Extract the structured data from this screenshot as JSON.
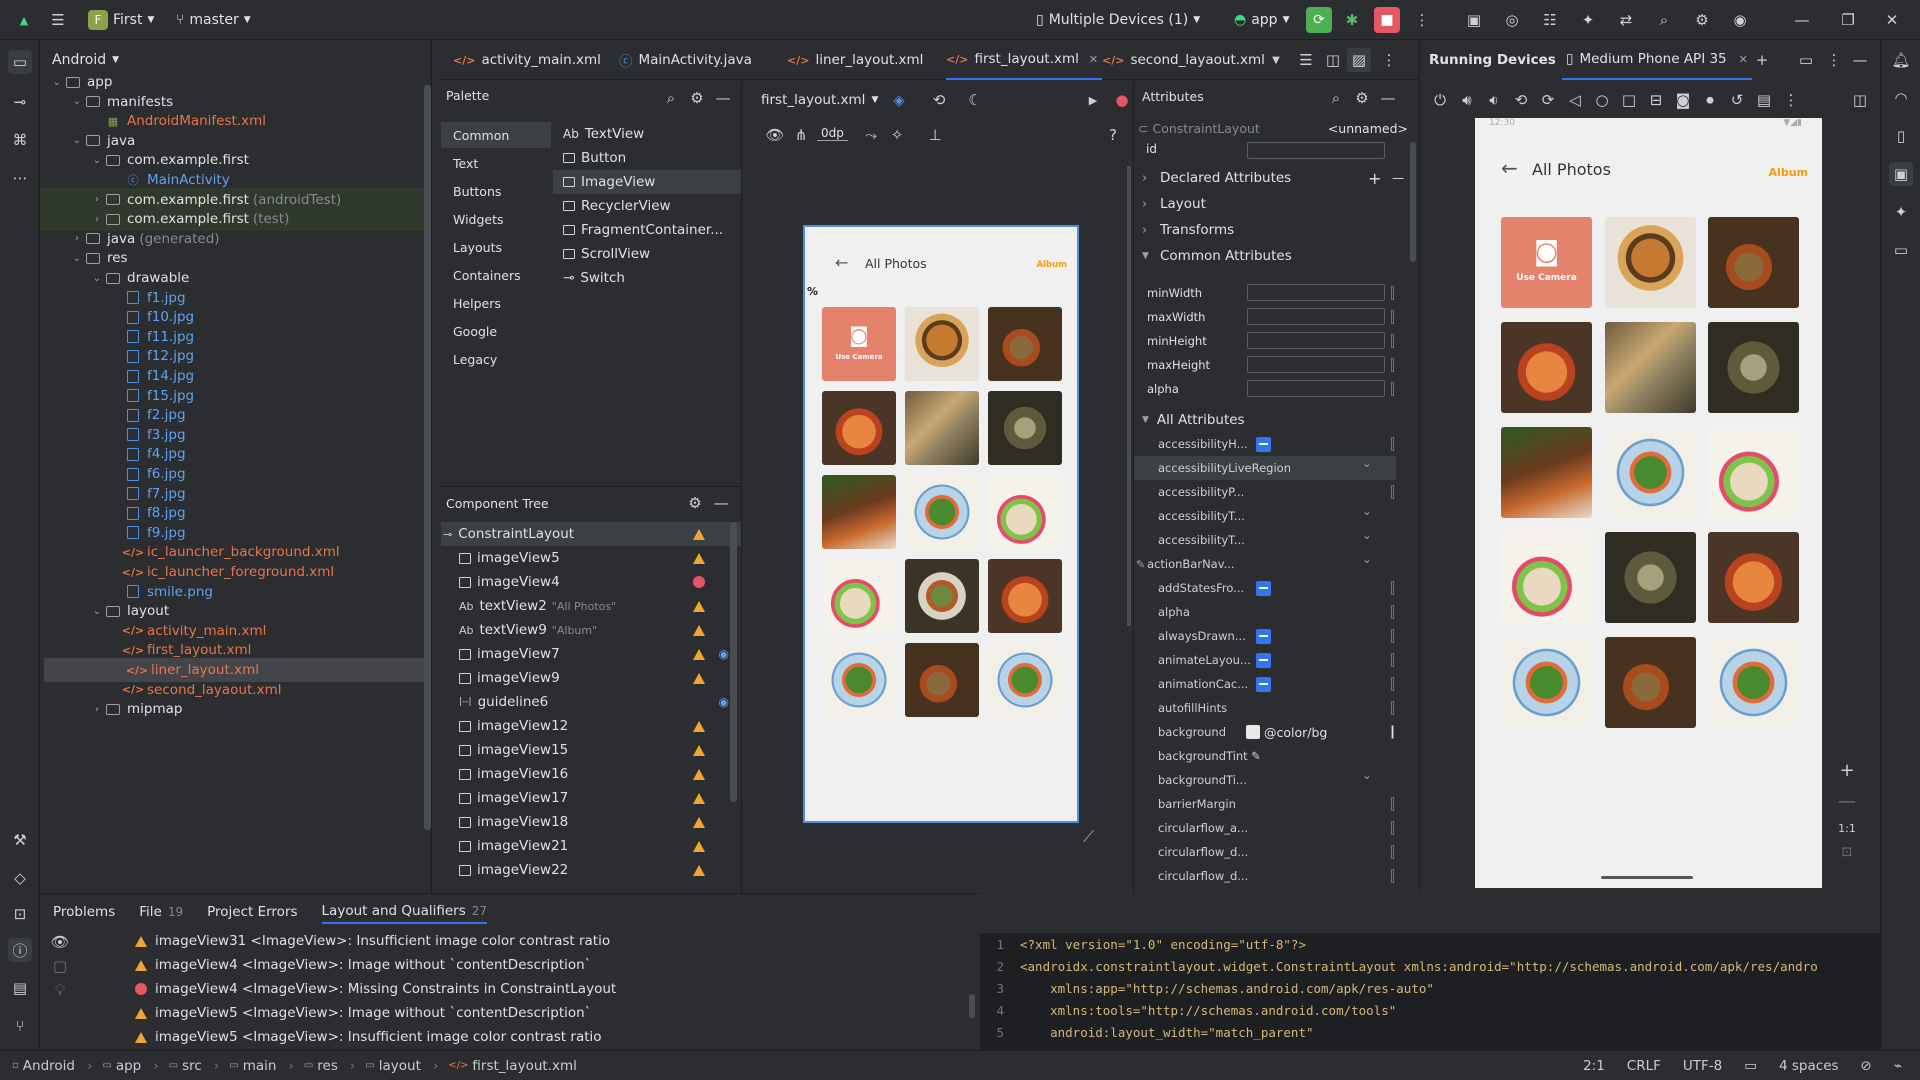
{
  "topbar": {
    "project_badge": "F",
    "project_name": "First",
    "branch": "master",
    "devices": "Multiple Devices (1)",
    "run_config": "app"
  },
  "project_panel": {
    "view_name": "Android",
    "tree": [
      {
        "label": "app",
        "depth": 0,
        "kind": "folder",
        "open": true
      },
      {
        "label": "manifests",
        "depth": 1,
        "kind": "folder",
        "open": true
      },
      {
        "label": "AndroidManifest.xml",
        "depth": 2,
        "kind": "manifest"
      },
      {
        "label": "java",
        "depth": 1,
        "kind": "folder",
        "open": true
      },
      {
        "label": "com.example.first",
        "depth": 2,
        "kind": "folder",
        "open": true
      },
      {
        "label": "MainActivity",
        "depth": 3,
        "kind": "class"
      },
      {
        "label": "com.example.first",
        "suffix": "(androidTest)",
        "depth": 2,
        "kind": "folder",
        "open": false,
        "hl": true
      },
      {
        "label": "com.example.first",
        "suffix": "(test)",
        "depth": 2,
        "kind": "folder",
        "open": false,
        "hl": true
      },
      {
        "label": "java",
        "suffix": "(generated)",
        "depth": 1,
        "kind": "folder"
      },
      {
        "label": "res",
        "depth": 1,
        "kind": "folder",
        "open": true
      },
      {
        "label": "drawable",
        "depth": 2,
        "kind": "folder",
        "open": true
      },
      {
        "label": "f1.jpg",
        "depth": 3,
        "kind": "image"
      },
      {
        "label": "f10.jpg",
        "depth": 3,
        "kind": "image"
      },
      {
        "label": "f11.jpg",
        "depth": 3,
        "kind": "image"
      },
      {
        "label": "f12.jpg",
        "depth": 3,
        "kind": "image"
      },
      {
        "label": "f14.jpg",
        "depth": 3,
        "kind": "image"
      },
      {
        "label": "f15.jpg",
        "depth": 3,
        "kind": "image"
      },
      {
        "label": "f2.jpg",
        "depth": 3,
        "kind": "image"
      },
      {
        "label": "f3.jpg",
        "depth": 3,
        "kind": "image"
      },
      {
        "label": "f4.jpg",
        "depth": 3,
        "kind": "image"
      },
      {
        "label": "f6.jpg",
        "depth": 3,
        "kind": "image"
      },
      {
        "label": "f7.jpg",
        "depth": 3,
        "kind": "image"
      },
      {
        "label": "f8.jpg",
        "depth": 3,
        "kind": "image"
      },
      {
        "label": "f9.jpg",
        "depth": 3,
        "kind": "image"
      },
      {
        "label": "ic_launcher_background.xml",
        "depth": 3,
        "kind": "xml"
      },
      {
        "label": "ic_launcher_foreground.xml",
        "depth": 3,
        "kind": "xml"
      },
      {
        "label": "smile.png",
        "depth": 3,
        "kind": "image"
      },
      {
        "label": "layout",
        "depth": 2,
        "kind": "folder",
        "open": true
      },
      {
        "label": "activity_main.xml",
        "depth": 3,
        "kind": "xml"
      },
      {
        "label": "first_layout.xml",
        "depth": 3,
        "kind": "xml"
      },
      {
        "label": "liner_layout.xml",
        "depth": 3,
        "kind": "xml",
        "selected": true
      },
      {
        "label": "second_layaout.xml",
        "depth": 3,
        "kind": "xml"
      },
      {
        "label": "mipmap",
        "depth": 2,
        "kind": "folder",
        "open": false
      }
    ]
  },
  "editor_tabs": [
    "activity_main.xml",
    "MainActivity.java",
    "liner_layout.xml",
    "first_layout.xml",
    "second_layaout.xml"
  ],
  "editor_active_tab": "first_layout.xml",
  "palette": {
    "title": "Palette",
    "categories": [
      "Common",
      "Text",
      "Buttons",
      "Widgets",
      "Layouts",
      "Containers",
      "Helpers",
      "Google",
      "Legacy"
    ],
    "items": [
      "TextView",
      "Button",
      "ImageView",
      "RecyclerView",
      "FragmentContainer...",
      "ScrollView",
      "Switch"
    ],
    "textview_prefix": "Ab"
  },
  "design_toolbar": {
    "file": "first_layout.xml",
    "margin": "0dp"
  },
  "component_tree": {
    "title": "Component Tree",
    "items": [
      {
        "label": "ConstraintLayout",
        "status": "warn",
        "root": true
      },
      {
        "label": "imageView5",
        "status": "warn"
      },
      {
        "label": "imageView4",
        "status": "error"
      },
      {
        "label": "textView2",
        "hint": "\"All Photos\"",
        "status": "warn",
        "text": true
      },
      {
        "label": "textView9",
        "hint": "\"Album\"",
        "status": "warn",
        "text": true
      },
      {
        "label": "imageView7",
        "status": "warn",
        "eye": true
      },
      {
        "label": "imageView9",
        "status": "warn"
      },
      {
        "label": "guideline6",
        "status": "eye",
        "guide": true
      },
      {
        "label": "imageView12",
        "status": "warn"
      },
      {
        "label": "imageView15",
        "status": "warn"
      },
      {
        "label": "imageView16",
        "status": "warn"
      },
      {
        "label": "imageView17",
        "status": "warn"
      },
      {
        "label": "imageView18",
        "status": "warn"
      },
      {
        "label": "imageView21",
        "status": "warn"
      },
      {
        "label": "imageView22",
        "status": "warn"
      }
    ]
  },
  "preview": {
    "title": "All Photos",
    "action": "Album",
    "camera_label": "Use Camera",
    "percent": "%",
    "grid": [
      [
        "camera",
        "burger",
        "salad"
      ],
      [
        "pasta",
        "spring",
        "dumpling"
      ],
      [
        "steak",
        "plate",
        "vegs"
      ],
      [
        "vegs",
        "bowl",
        "pasta"
      ],
      [
        "plate",
        "salad",
        "plate"
      ]
    ]
  },
  "attributes": {
    "title": "Attributes",
    "component": "ConstraintLayout",
    "unnamed": "<unnamed>",
    "id_label": "id",
    "sections": [
      "Declared Attributes",
      "Layout",
      "Transforms",
      "Common Attributes"
    ],
    "common": [
      "minWidth",
      "maxWidth",
      "minHeight",
      "maxHeight",
      "alpha"
    ],
    "all_title": "All Attributes",
    "all": [
      {
        "name": "accessibilityH...",
        "ctl": "check"
      },
      {
        "name": "accessibilityLiveRegion",
        "ctl": "dropdown",
        "hl": true
      },
      {
        "name": "accessibilityP...",
        "ctl": "sep"
      },
      {
        "name": "accessibilityT...",
        "ctl": "dropdown"
      },
      {
        "name": "accessibilityT...",
        "ctl": "dropdown"
      },
      {
        "name": "actionBarNav...",
        "ctl": "dropdown",
        "pin": true
      },
      {
        "name": "addStatesFro...",
        "ctl": "check"
      },
      {
        "name": "alpha",
        "ctl": "sep"
      },
      {
        "name": "alwaysDrawn...",
        "ctl": "check"
      },
      {
        "name": "animateLayou...",
        "ctl": "check"
      },
      {
        "name": "animationCac...",
        "ctl": "check"
      },
      {
        "name": "autofillHints",
        "ctl": "sep"
      },
      {
        "name": "background",
        "ctl": "color",
        "value": "@color/bg"
      },
      {
        "name": "backgroundTint",
        "ctl": "picker"
      },
      {
        "name": "backgroundTi...",
        "ctl": "dropdown"
      },
      {
        "name": "barrierMargin",
        "ctl": "sep"
      },
      {
        "name": "circularflow_a...",
        "ctl": "sep"
      },
      {
        "name": "circularflow_d...",
        "ctl": "sep"
      },
      {
        "name": "circularflow_d...",
        "ctl": "sep"
      }
    ]
  },
  "running_devices": {
    "title": "Running Devices",
    "device_tab": "Medium Phone API 35",
    "clock": "12:30",
    "title_text": "All Photos",
    "action": "Album",
    "camera_label": "Use Camera",
    "zoom_label": "1:1",
    "grid": [
      [
        "camera",
        "burger",
        "salad"
      ],
      [
        "pasta",
        "spring",
        "dumpling"
      ],
      [
        "steak",
        "plate",
        "vegs"
      ],
      [
        "vegs",
        "dumpling",
        "pasta"
      ],
      [
        "plate",
        "salad",
        "plate"
      ]
    ]
  },
  "problems": {
    "tabs": [
      {
        "label": "Problems"
      },
      {
        "label": "File",
        "count": "19"
      },
      {
        "label": "Project Errors"
      },
      {
        "label": "Layout and Qualifiers",
        "count": "27"
      }
    ],
    "rows": [
      {
        "level": "warn",
        "text": "imageView31 <ImageView>: Insufficient image color contrast ratio"
      },
      {
        "level": "warn",
        "text": "imageView4 <ImageView>: Image without `contentDescription`"
      },
      {
        "level": "error",
        "text": "imageView4 <ImageView>: Missing Constraints in ConstraintLayout"
      },
      {
        "level": "warn",
        "text": "imageView5 <ImageView>: Image without `contentDescription`"
      },
      {
        "level": "warn",
        "text": "imageView5 <ImageView>: Insufficient image color contrast ratio"
      }
    ]
  },
  "code": {
    "lines": [
      {
        "n": "1",
        "text": "<?xml version=\"1.0\" encoding=\"utf-8\"?>"
      },
      {
        "n": "2",
        "text": "<androidx.constraintlayout.widget.ConstraintLayout xmlns:android=\"http://schemas.android.com/apk/res/andro"
      },
      {
        "n": "3",
        "text": "    xmlns:app=\"http://schemas.android.com/apk/res-auto\""
      },
      {
        "n": "4",
        "text": "    xmlns:tools=\"http://schemas.android.com/tools\""
      },
      {
        "n": "5",
        "text": "    android:layout_width=\"match_parent\""
      }
    ]
  },
  "statusbar": {
    "crumbs": [
      "Android",
      "app",
      "src",
      "main",
      "res",
      "layout",
      "first_layout.xml"
    ],
    "position": "2:1",
    "line_sep": "CRLF",
    "encoding": "UTF-8",
    "indent": "4 spaces"
  },
  "colors": {
    "accent": "#3574f0",
    "warning": "#f0a732",
    "error": "#e55765",
    "run": "#4caf50",
    "stop": "#e55765",
    "album": "#f39c12",
    "camera_tile": "#e4826b"
  }
}
